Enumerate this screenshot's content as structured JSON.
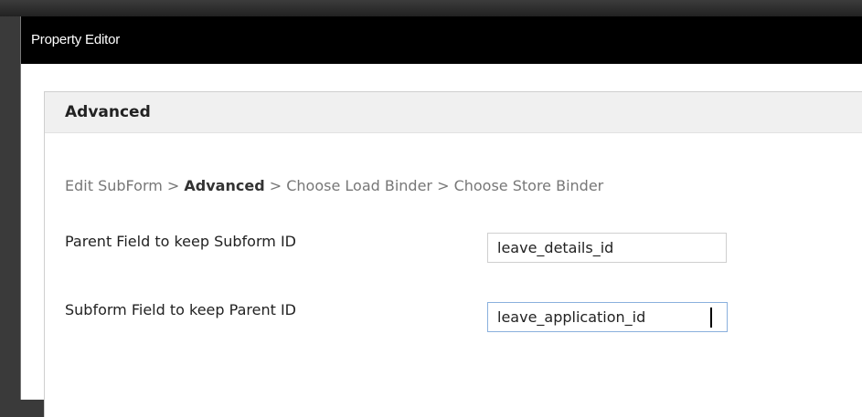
{
  "dialog": {
    "title": "Property Editor"
  },
  "panel": {
    "title": "Advanced"
  },
  "breadcrumb": {
    "step1": "Edit SubForm",
    "sep1": " > ",
    "step2": "Advanced",
    "sep2": " > ",
    "step3": "Choose Load Binder",
    "sep3": " > ",
    "step4": "Choose Store Binder"
  },
  "fields": [
    {
      "label": "Parent Field to keep Subform ID",
      "value": "leave_details_id"
    },
    {
      "label": "Subform Field to keep Parent ID",
      "value": "leave_application_id"
    }
  ]
}
